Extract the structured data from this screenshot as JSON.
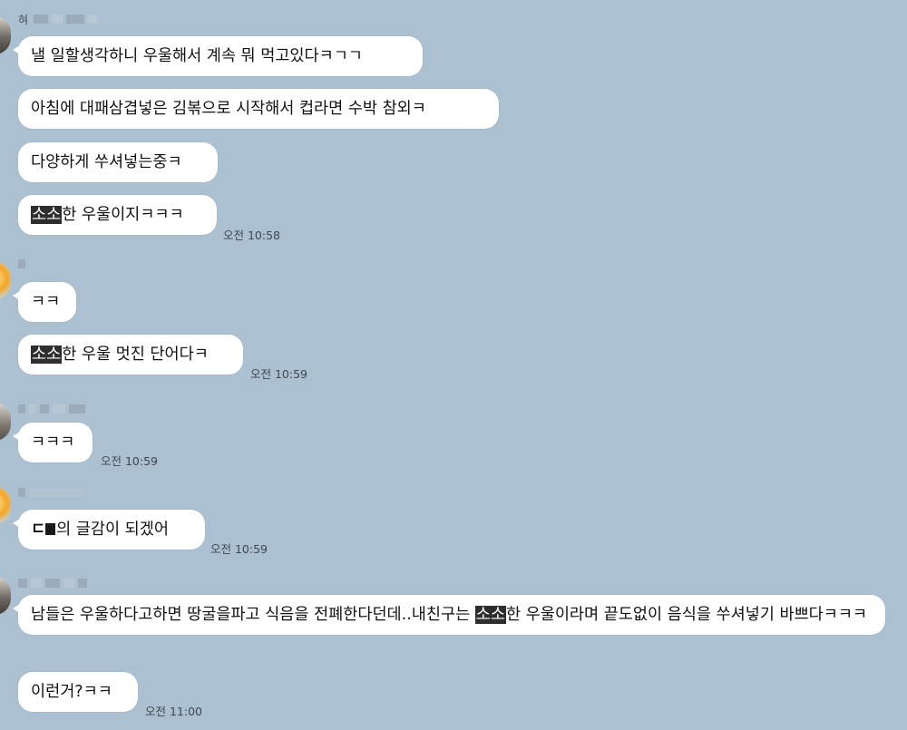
{
  "chat": {
    "groups": [
      {
        "sender_label": "혀",
        "messages": [
          {
            "text": "낼 일할생각하니 우울해서 계속 뭐 먹고있다ㅋㄱㄱ"
          },
          {
            "text": "아침에 대패삼겹넣은 김볶으로 시작해서  컵라면 수박 참외ㅋ"
          },
          {
            "text": "다양하게 쑤셔넣는중ㅋ"
          },
          {
            "highlight": "소소",
            "text": "한 우울이지ㅋㅋㅋ",
            "time": "오전 10:58"
          }
        ]
      },
      {
        "messages": [
          {
            "text": "ㅋㅋ"
          },
          {
            "highlight": "소소",
            "text": "한 우울 멋진 단어다ㅋ",
            "time": "오전 10:59"
          }
        ]
      },
      {
        "messages": [
          {
            "text": "ㅋㅋㅋ",
            "time": "오전 10:59"
          }
        ]
      },
      {
        "messages": [
          {
            "prefix": "ㄷ",
            "text": "의 글감이 되겠어",
            "time": "오전 10:59"
          }
        ]
      },
      {
        "messages": [
          {
            "text_before": "남들은 우울하다고하면 땅굴을파고 식음을 전폐한다던데..내친구는 ",
            "highlight": "소소",
            "text_after": "한 우울이라며 끝도없이 음식을 쑤셔넣기 바쁘다ㅋㅋㅋ"
          },
          {
            "text": "이런거?ㅋㅋ",
            "time": "오전 11:00"
          }
        ]
      }
    ]
  }
}
